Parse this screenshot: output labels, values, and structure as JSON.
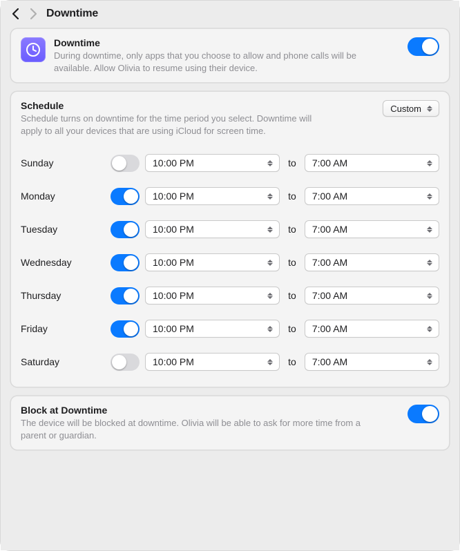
{
  "header": {
    "title": "Downtime"
  },
  "downtime": {
    "title": "Downtime",
    "description": "During downtime, only apps that you choose to allow and phone calls will be available. Allow Olivia to resume using their device.",
    "enabled": true
  },
  "schedule": {
    "title": "Schedule",
    "description": "Schedule turns on downtime for the time period you select. Downtime will apply to all your devices that are using iCloud for screen time.",
    "mode": "Custom",
    "to_label": "to",
    "days": [
      {
        "name": "Sunday",
        "enabled": false,
        "from": "10:00 PM",
        "to": "7:00 AM"
      },
      {
        "name": "Monday",
        "enabled": true,
        "from": "10:00 PM",
        "to": "7:00 AM"
      },
      {
        "name": "Tuesday",
        "enabled": true,
        "from": "10:00 PM",
        "to": "7:00 AM"
      },
      {
        "name": "Wednesday",
        "enabled": true,
        "from": "10:00 PM",
        "to": "7:00 AM"
      },
      {
        "name": "Thursday",
        "enabled": true,
        "from": "10:00 PM",
        "to": "7:00 AM"
      },
      {
        "name": "Friday",
        "enabled": true,
        "from": "10:00 PM",
        "to": "7:00 AM"
      },
      {
        "name": "Saturday",
        "enabled": false,
        "from": "10:00 PM",
        "to": "7:00 AM"
      }
    ]
  },
  "block": {
    "title": "Block at Downtime",
    "description": "The device will be blocked at downtime. Olivia will be able to ask for more time from a parent or guardian.",
    "enabled": true
  },
  "colors": {
    "accent": "#0a7aff"
  }
}
